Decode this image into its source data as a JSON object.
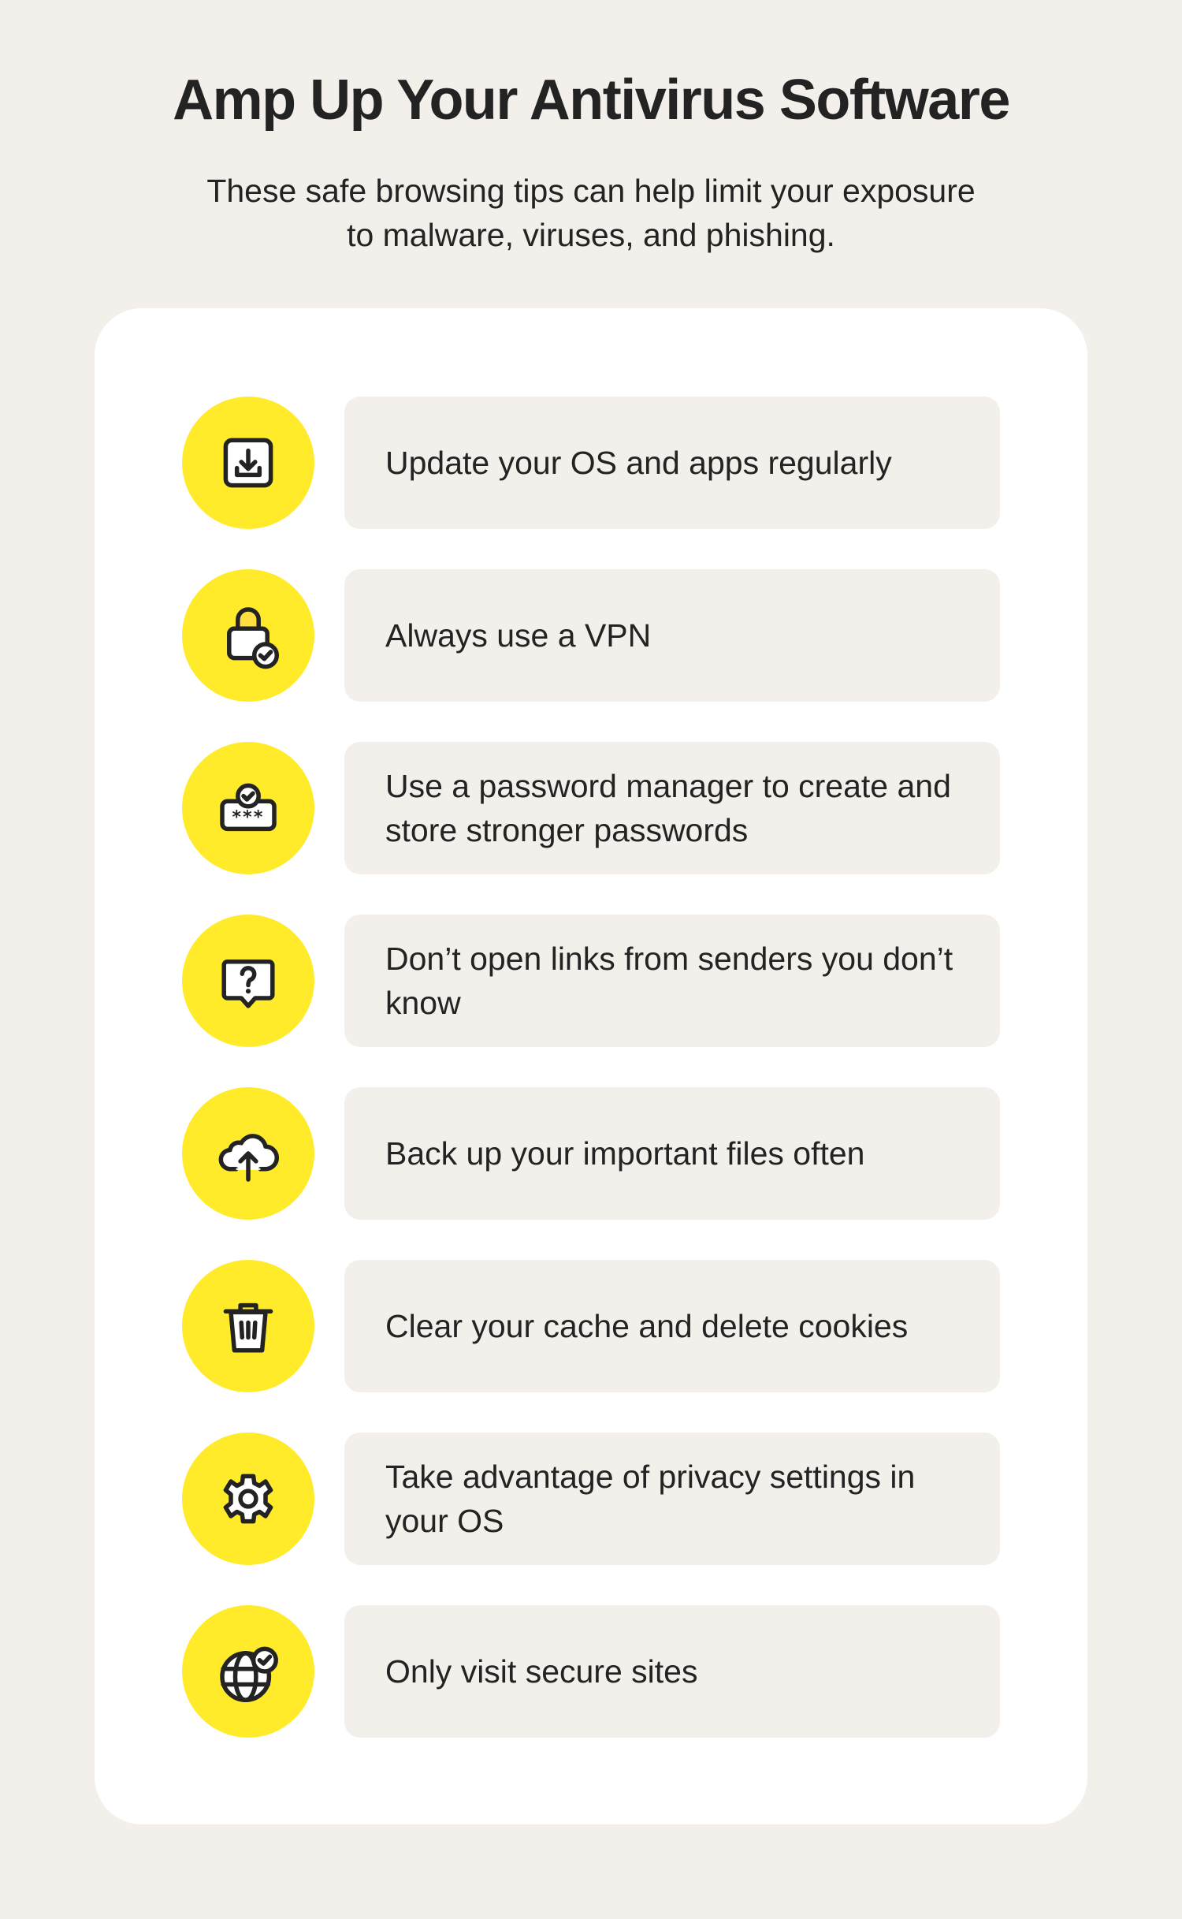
{
  "header": {
    "title": "Amp Up Your Antivirus Software",
    "subtitle": "These safe browsing tips can help limit your exposure to malware, viruses, and phishing."
  },
  "colors": {
    "background": "#f3f0eb",
    "card": "#ffffff",
    "accent_yellow": "#ffeb2a",
    "tip_box": "#f3f0eb",
    "text": "#232323"
  },
  "tips": [
    {
      "icon": "download-icon",
      "text": "Update your OS and apps regularly"
    },
    {
      "icon": "lock-check-icon",
      "text": "Always use a VPN"
    },
    {
      "icon": "password-check-icon",
      "text": "Use a password manager to create and store stronger passwords"
    },
    {
      "icon": "question-bubble-icon",
      "text": "Don’t open links from senders you don’t know"
    },
    {
      "icon": "cloud-upload-icon",
      "text": "Back up your important files often"
    },
    {
      "icon": "trash-icon",
      "text": "Clear your cache and delete cookies"
    },
    {
      "icon": "gear-icon",
      "text": "Take advantage of privacy settings in your OS"
    },
    {
      "icon": "globe-check-icon",
      "text": "Only visit secure sites"
    }
  ]
}
